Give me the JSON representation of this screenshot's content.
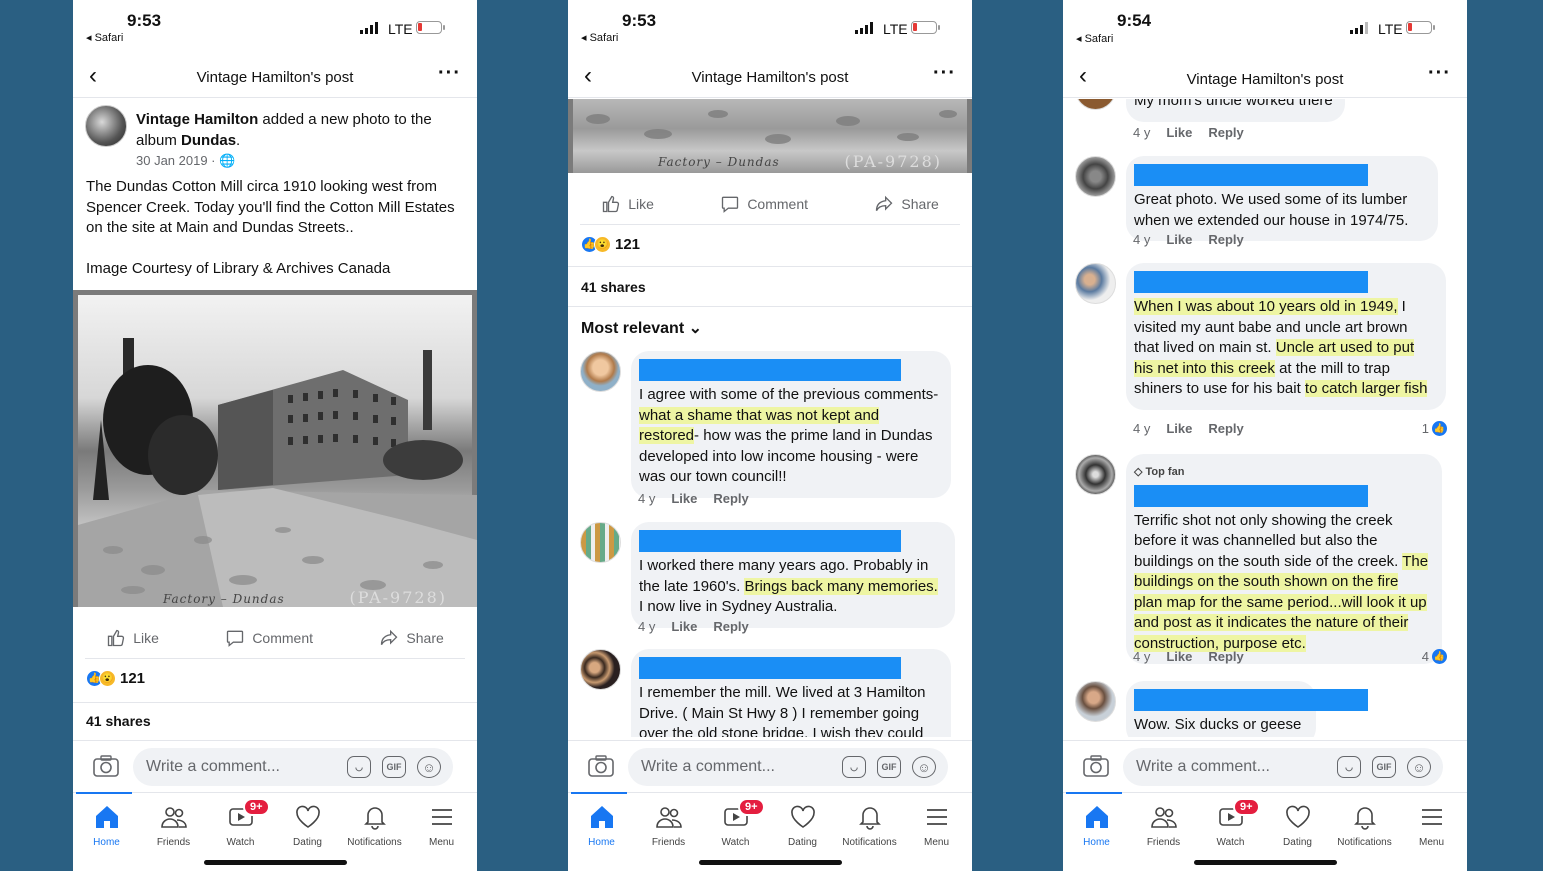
{
  "screens": [
    {
      "time": "9:53",
      "back_app": "◂ Safari",
      "network": "LTE",
      "nav_title": "Vintage Hamilton's post",
      "post": {
        "author": "Vintage Hamilton",
        "action_text": " added a new photo to the album ",
        "album": "Dundas",
        "date": "30 Jan 2019 · 🌐",
        "text": "The Dundas Cotton Mill circa 1910 looking west from Spencer Creek. Today you'll find the Cotton Mill Estates on the site at Main and Dundas Streets..\n\nImage Courtesy of Library & Archives Canada",
        "photo_caption": "Factory – Dundas",
        "photo_ref": "(PA-9728)"
      },
      "reactions_count": "121",
      "shares": "41 shares"
    },
    {
      "time": "9:53",
      "back_app": "◂ Safari",
      "network": "LTE",
      "nav_title": "Vintage Hamilton's post",
      "reactions_count": "121",
      "shares": "41 shares",
      "sort_label": "Most relevant ⌄",
      "comments": [
        {
          "parts": [
            "I agree with some of the previous comments- ",
            "what a shame that was not kept and restored",
            "- how was the prime land in Dundas developed into low income housing - were was our town council!!"
          ],
          "age": "4 y"
        },
        {
          "parts": [
            "I worked there many years ago.  Probably in the late 1960's. ",
            "Brings back many memories.",
            " I now live in Sydney Australia."
          ],
          "age": "4 y"
        },
        {
          "parts": [
            "I remember the mill. We lived at 3 Hamilton Drive. ( Main St  Hwy 8 ) I remember going over the old stone bridge. I wish they could",
            "",
            ""
          ],
          "age": ""
        }
      ]
    },
    {
      "time": "9:54",
      "back_app": "◂ Safari",
      "network": "LTE",
      "nav_title": "Vintage Hamilton's post",
      "comments": [
        {
          "text": "My mom's uncle worked there",
          "age": "4 y"
        },
        {
          "text": "Great photo.  We used some of its lumber when we extended our house in 1974/75.",
          "age": "4 y"
        },
        {
          "parts": [
            "When I was about 10 years old in 1949,",
            " I visited my aunt babe and uncle art brown that lived on main st. ",
            "Uncle art used to put his net into this creek",
            " at the mill to trap shiners to use for his bait ",
            "to catch larger fish"
          ],
          "age": "4 y",
          "reactions": "1"
        },
        {
          "badge": "Top fan",
          "parts": [
            "Terrific shot not only showing the creek before it was channelled but also the buildings on the south side of the creek. ",
            "The buildings on the south shown on the fire plan map for the same period...will look it up and post as it indicates the nature of their construction, purpose etc."
          ],
          "age": "4 y",
          "reactions": "4"
        },
        {
          "text": "Wow. Six ducks or geese",
          "age": ""
        }
      ]
    }
  ],
  "actions": {
    "like": "Like",
    "comment": "Comment",
    "share": "Share",
    "reply": "Reply"
  },
  "composer": {
    "placeholder": "Write a comment...",
    "gif": "GIF"
  },
  "tabs": [
    {
      "label": "Home",
      "icon": "home-icon"
    },
    {
      "label": "Friends",
      "icon": "friends-icon"
    },
    {
      "label": "Watch",
      "icon": "watch-icon",
      "badge": "9+"
    },
    {
      "label": "Dating",
      "icon": "heart-icon"
    },
    {
      "label": "Notifications",
      "icon": "bell-icon"
    },
    {
      "label": "Menu",
      "icon": "menu-icon"
    }
  ],
  "colors": {
    "accent": "#1877f2",
    "highlight": "#eef5a3",
    "redaction": "#1a8ef5",
    "background": "#2a5f82"
  }
}
